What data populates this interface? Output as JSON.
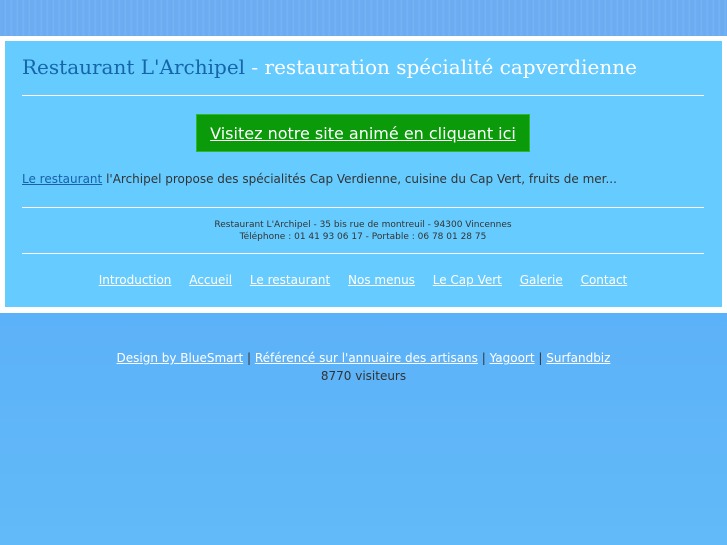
{
  "header": {
    "brand": "Restaurant L'Archipel",
    "tagline": " - restauration spécialité capverdienne"
  },
  "cta": {
    "label": "Visitez notre site animé en cliquant ici"
  },
  "intro": {
    "link": "Le restaurant",
    "text": " l'Archipel propose des spécialités Cap Verdienne, cuisine du Cap Vert, fruits de mer..."
  },
  "address": {
    "line1": "Restaurant L'Archipel - 35 bis rue de montreuil - 94300 Vincennes",
    "line2": "Téléphone : 01 41 93 06 17 - Portable : 06 78 01 28 75"
  },
  "nav": {
    "items": [
      "Introduction",
      "Accueil",
      "Le restaurant",
      "Nos menus",
      "Le Cap Vert",
      "Galerie",
      "Contact"
    ]
  },
  "footer": {
    "links": [
      "Design by BlueSmart",
      "Référencé sur l'annuaire des artisans",
      "Yagoort",
      "Surfandbiz"
    ],
    "separator": " | ",
    "visitors": "8770 visiteurs"
  },
  "colors": {
    "panel": "#66ccff",
    "cta": "#0a9a0a",
    "brand": "#1565a8",
    "background": "#5aaef8"
  }
}
